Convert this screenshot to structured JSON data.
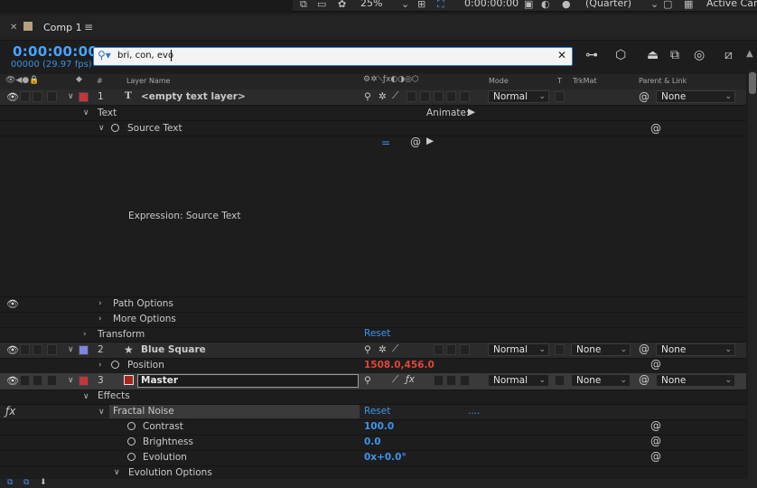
{
  "topbar": {
    "zoom": "25%",
    "timecode": "0:00:00:00",
    "resolution": "(Quarter)",
    "camera": "Active Came"
  },
  "tab": {
    "title": "Comp 1"
  },
  "timeline": {
    "timecode": "0:00:00:00",
    "frames": "00000 (29.97 fps)",
    "search_value": "bri, con, evo"
  },
  "headers": {
    "hash": "#",
    "layer_name": "Layer Name",
    "mode": "Mode",
    "t": "T",
    "trkmat": "TrkMat",
    "parent": "Parent & Link"
  },
  "layers": {
    "l1": {
      "num": "1",
      "name": "<empty text layer>",
      "mode": "Normal",
      "parent": "None",
      "color": "#c4353a"
    },
    "text_group": "Text",
    "animate": "Animate:",
    "source_text": "Source Text",
    "expression": "Expression: Source Text",
    "path_options": "Path Options",
    "more_options": "More Options",
    "transform": "Transform",
    "transform_reset": "Reset",
    "l2": {
      "num": "2",
      "name": "Blue Square",
      "mode": "Normal",
      "trkmat": "None",
      "parent": "None",
      "color": "#7a86e0"
    },
    "position": {
      "label": "Position",
      "value_x": "1508.0",
      "value_y": "456.0"
    },
    "l3": {
      "num": "3",
      "name": "Master",
      "mode": "Normal",
      "trkmat": "None",
      "parent": "None",
      "color": "#c4353a"
    },
    "effects": "Effects",
    "fractal_noise": "Fractal Noise",
    "fractal_reset": "Reset",
    "fractal_dots": "....",
    "contrast": {
      "label": "Contrast",
      "value": "100.0"
    },
    "brightness": {
      "label": "Brightness",
      "value": "0.0"
    },
    "evolution": {
      "label": "Evolution",
      "value": "0x+0.0°"
    },
    "evolution_options": "Evolution Options"
  }
}
